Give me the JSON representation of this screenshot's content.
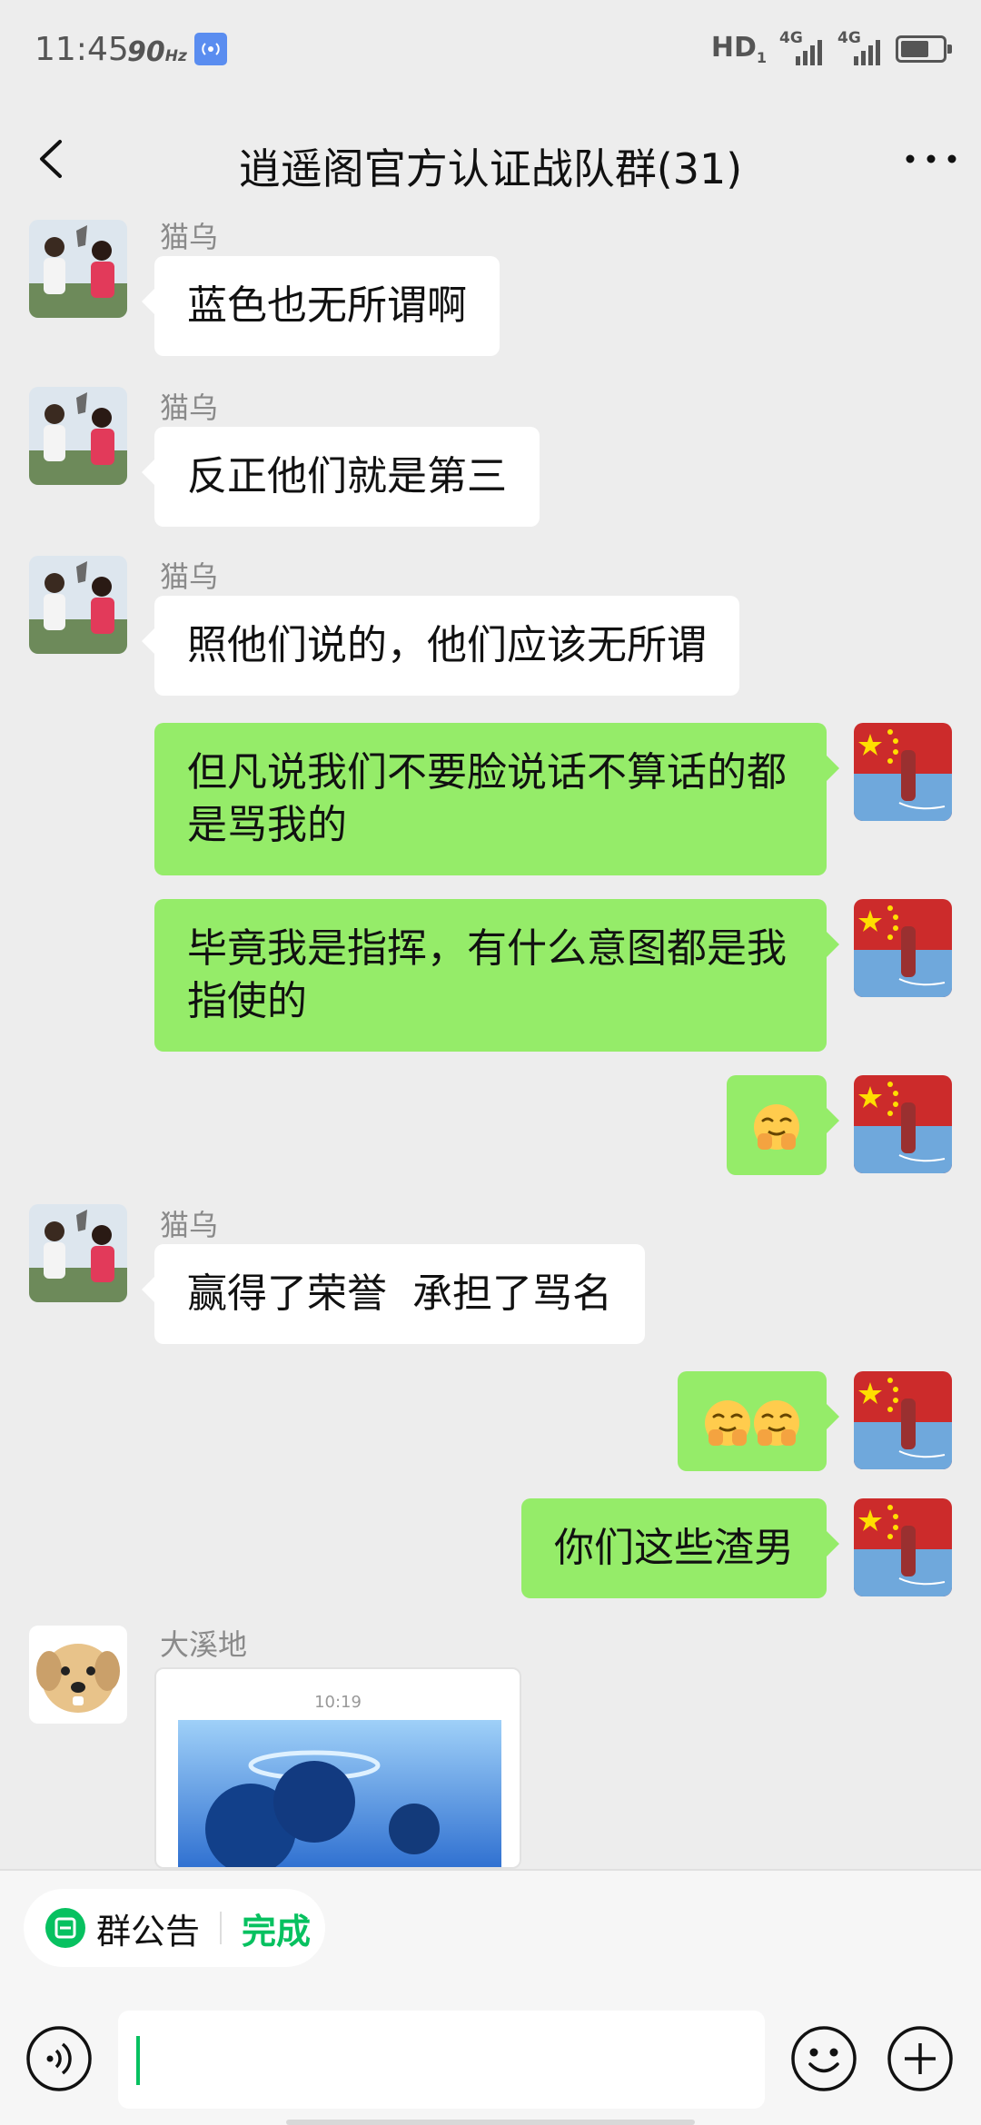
{
  "status_bar": {
    "time": "11:45",
    "refresh_rate": "90",
    "refresh_unit": "Hz",
    "hd": "HD",
    "hd_sub": "1",
    "net1": "4G",
    "net2": "4G"
  },
  "header": {
    "title": "逍遥阁官方认证战队群(31)",
    "back_icon": "chevron-left-icon",
    "more_icon": "more-dots-icon"
  },
  "messages": [
    {
      "side": "left",
      "sender": "猫乌",
      "text": "蓝色也无所谓啊"
    },
    {
      "side": "left",
      "sender": "猫乌",
      "text": "反正他们就是第三"
    },
    {
      "side": "left",
      "sender": "猫乌",
      "text": "照他们说的，他们应该无所谓"
    },
    {
      "side": "right",
      "line1": "但凡说我们不要脸说话不算话的都",
      "line2": "是骂我的"
    },
    {
      "side": "right",
      "line1": "毕竟我是指挥，有什么意图都是我",
      "line2": "指使的"
    },
    {
      "side": "right",
      "emoji": "smirk-hands-emoji"
    },
    {
      "side": "left",
      "sender": "猫乌",
      "text": "赢得了荣誉  承担了骂名"
    },
    {
      "side": "right",
      "emoji": "smirk-hands-emoji-x2"
    },
    {
      "side": "right",
      "text": "你们这些渣男"
    },
    {
      "side": "left",
      "sender": "大溪地",
      "image_card": {
        "time": "10:19"
      }
    }
  ],
  "bottom": {
    "announcement": {
      "label": "群公告",
      "action": "完成"
    },
    "input_value": "",
    "voice_icon": "voice-icon",
    "emoji_icon": "smiley-icon",
    "plus_icon": "plus-icon"
  },
  "colors": {
    "background": "#ededed",
    "self_bubble": "#95ec69",
    "other_bubble": "#ffffff",
    "accent": "#07c160"
  }
}
